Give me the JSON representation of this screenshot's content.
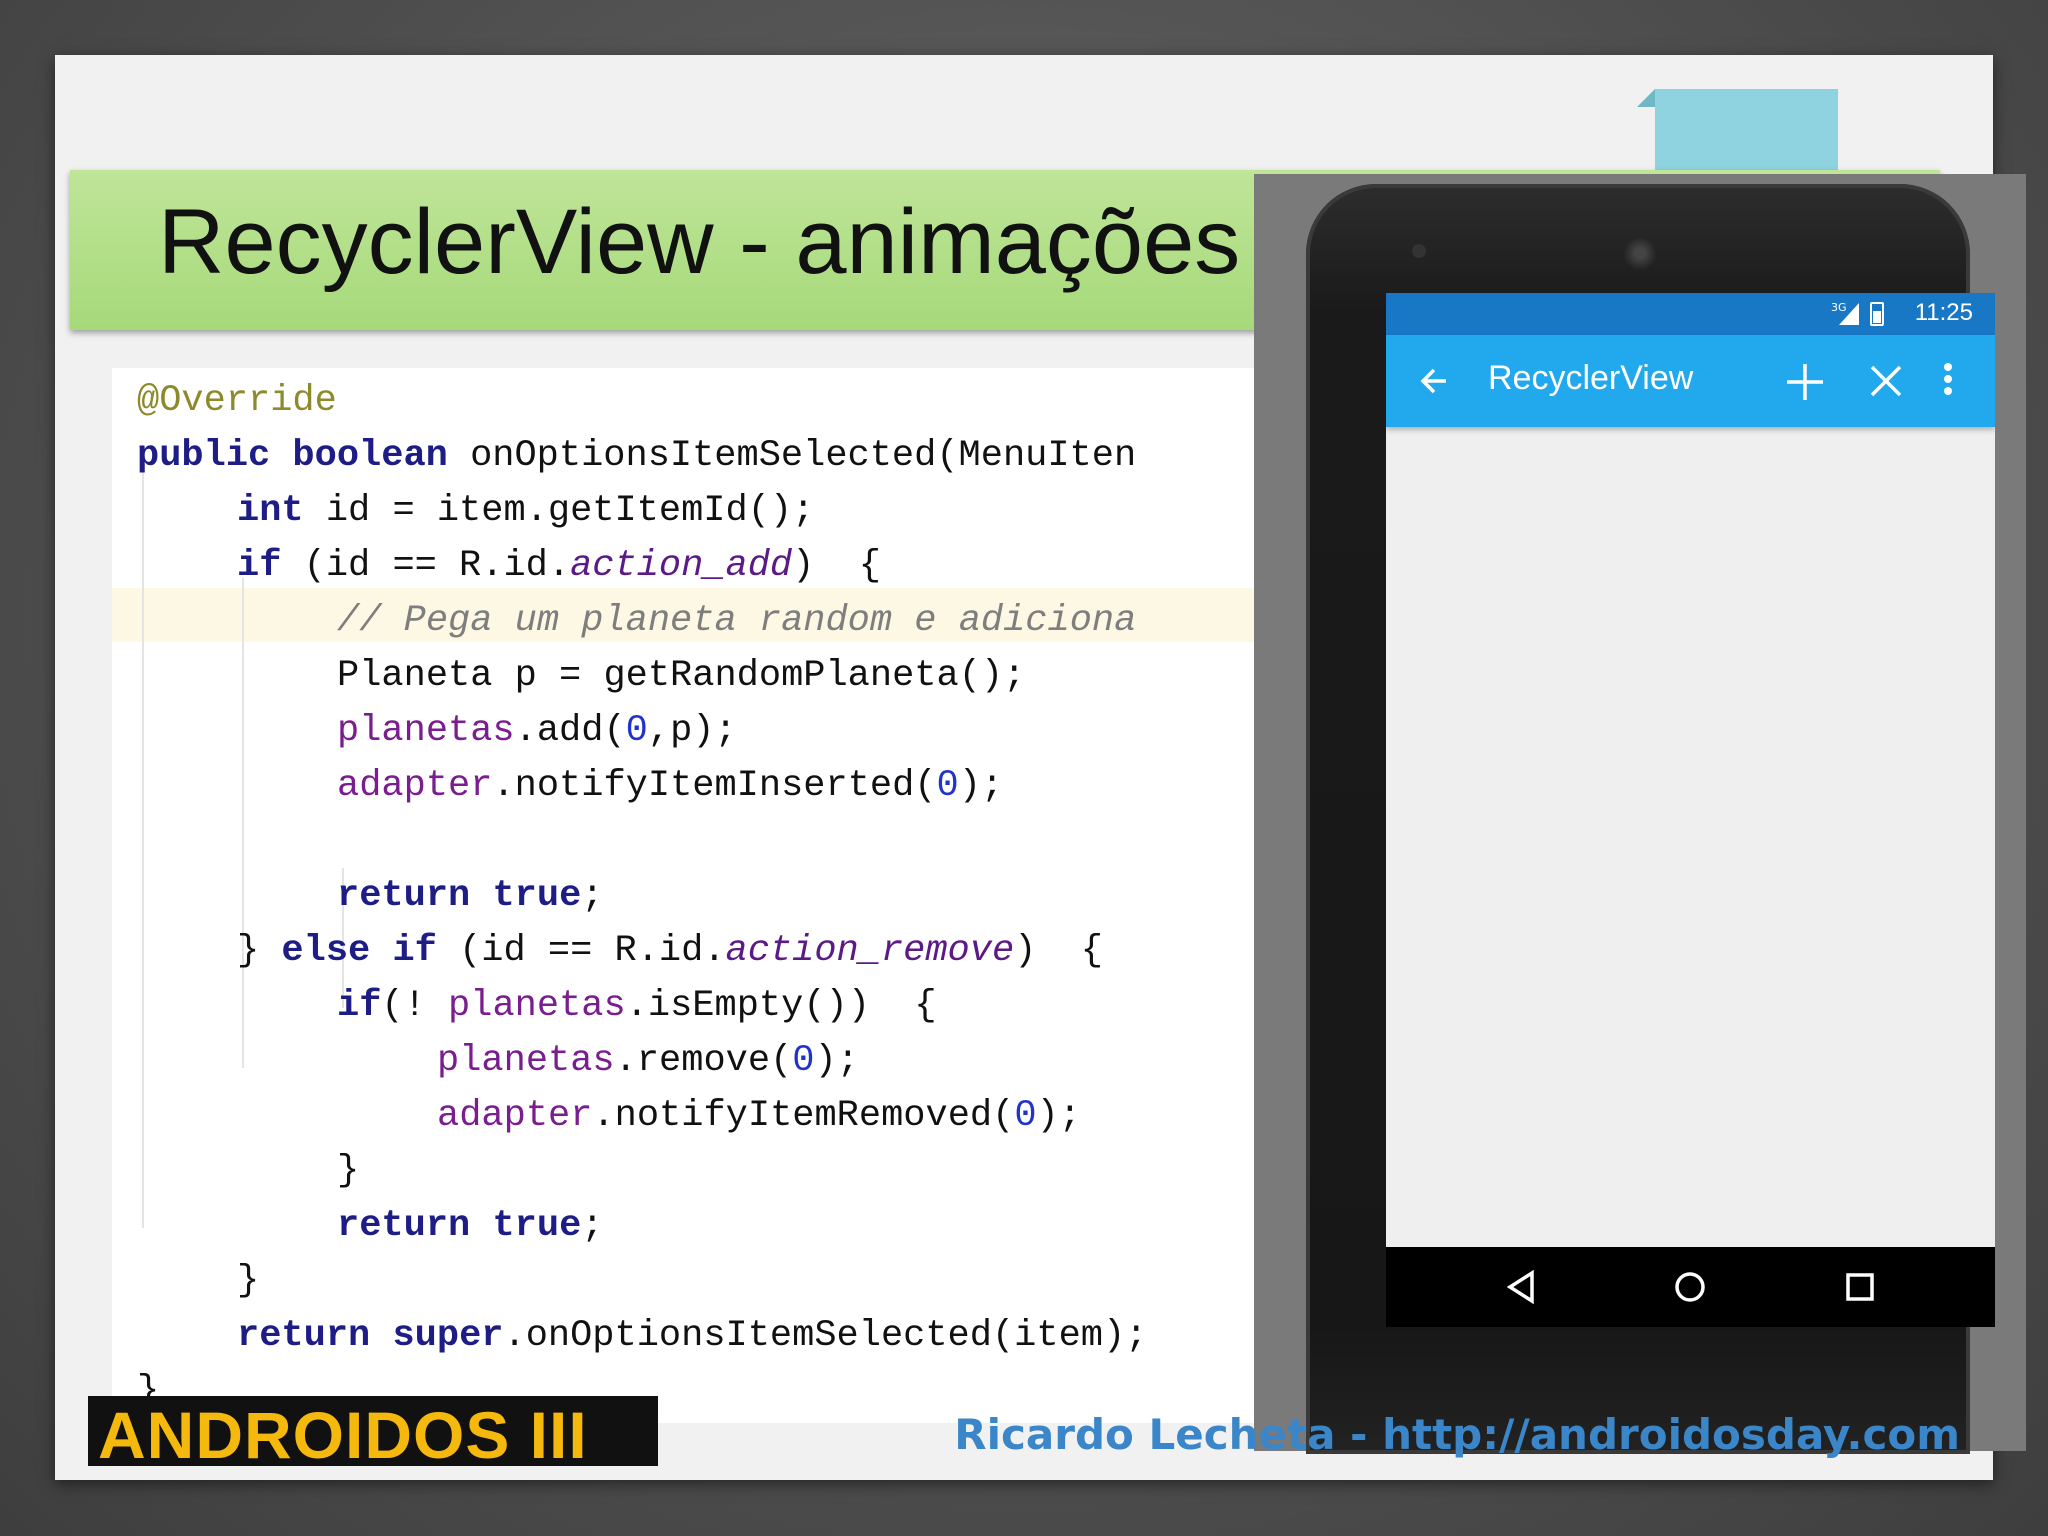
{
  "slide": {
    "title": "RecyclerView - animações",
    "logo_text": "ANDROIDOS III",
    "credit": "Ricardo Lecheta - http://androidosday.com"
  },
  "code": {
    "l1": "@Override",
    "l2_kw1": "public boolean",
    "l2_rest": " onOptionsItemSelected(MenuIten",
    "l3_kw": "int",
    "l3_rest": " id = item.getItemId();",
    "l4_kw": "if",
    "l4_a": " (id == R.id.",
    "l4_it": "action_add",
    "l4_b": ")  {",
    "l5": "// Pega um planeta random e adiciona",
    "l6": "Planeta p = getRandomPlaneta();",
    "l7_fld": "planetas",
    "l7_a": ".add(",
    "l7_num": "0",
    "l7_b": ",p);",
    "l8_fld": "adapter",
    "l8_a": ".notifyItemInserted(",
    "l8_num": "0",
    "l8_b": ");",
    "l9_kw1": "return",
    "l9_kw2": "true",
    "l9_end": ";",
    "l10_a": "} ",
    "l10_kw": "else if",
    "l10_b": " (id == R.id.",
    "l10_it": "action_remove",
    "l10_c": ")  {",
    "l11_kw": "if",
    "l11_a": "(! ",
    "l11_fld": "planetas",
    "l11_b": ".isEmpty())  {",
    "l12_fld": "planetas",
    "l12_a": ".remove(",
    "l12_num": "0",
    "l12_b": ");",
    "l13_fld": "adapter",
    "l13_a": ".notifyItemRemoved(",
    "l13_num": "0",
    "l13_b": ");",
    "l14": "}",
    "l15_kw1": "return",
    "l15_kw2": "true",
    "l15_end": ";",
    "l16": "}",
    "l17_kw1": "return",
    "l17_kw2": "super",
    "l17_rest": ".onOptionsItemSelected(item);",
    "l18": "}"
  },
  "phone": {
    "status_time": "11:25",
    "network_label": "3G",
    "app_title": "RecyclerView",
    "colors": {
      "status_bar": "#1978c6",
      "app_bar": "#22a8ec",
      "title_band": "#a6d97a",
      "logo_yellow": "#f5b80c",
      "credit_blue": "#3a86c8"
    },
    "icons": [
      "back-arrow-icon",
      "add-icon",
      "close-icon",
      "overflow-menu-icon",
      "nav-back-icon",
      "nav-home-icon",
      "nav-recents-icon",
      "signal-icon",
      "battery-icon"
    ]
  }
}
